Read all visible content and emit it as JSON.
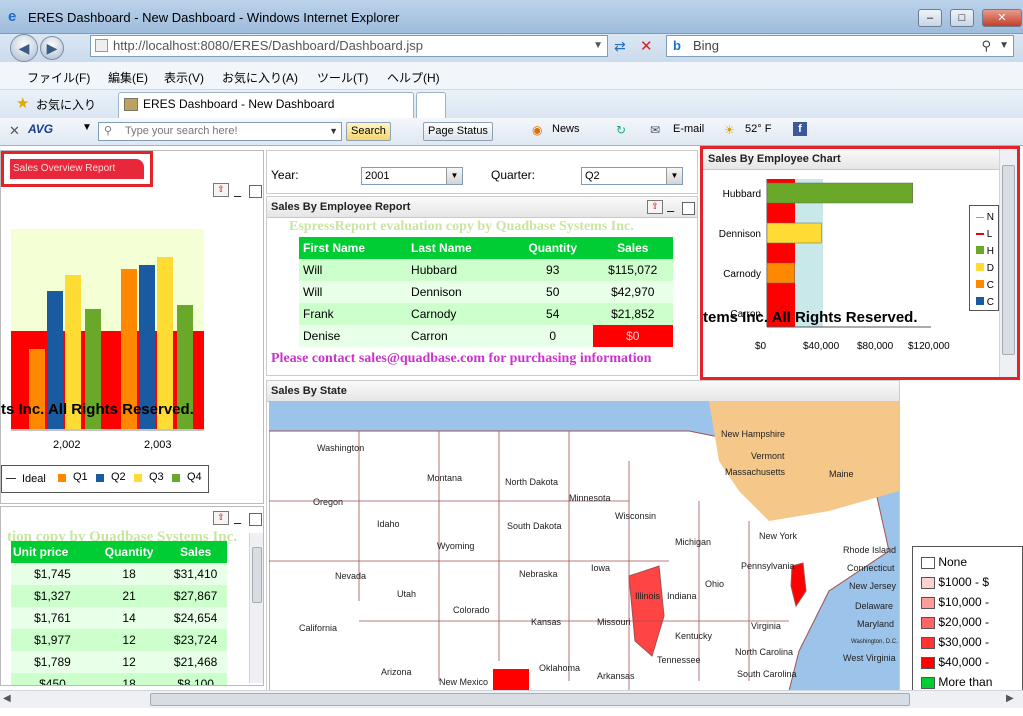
{
  "window": {
    "title": "ERES Dashboard - New Dashboard - Windows Internet Explorer",
    "min": "–",
    "max": "□",
    "close": "✕"
  },
  "address": {
    "url": "http://localhost:8080/ERES/Dashboard/Dashboard.jsp",
    "search_engine": "Bing"
  },
  "menu": [
    "ファイル(F)",
    "編集(E)",
    "表示(V)",
    "お気に入り(A)",
    "ツール(T)",
    "ヘルプ(H)"
  ],
  "favorites": {
    "label": "お気に入り",
    "tab_title": "ERES Dashboard - New Dashboard"
  },
  "toolbar": {
    "avg": "AVG",
    "search_placeholder": "Type your search here!",
    "search_btn": "Search",
    "page_status": "Page Status",
    "news": "News",
    "email": "E-mail",
    "weather": "52° F"
  },
  "left_panel": {
    "tab_label": "Sales Overview Report",
    "watermark": "ts Inc. All Rights Reserved.",
    "x_ticks": [
      "2,002",
      "2,003"
    ],
    "legend": [
      "Ideal",
      "Q1",
      "Q2",
      "Q3",
      "Q4"
    ],
    "table_watermark": "tion copy by Quadbase Systems Inc.",
    "table_headers": [
      "Unit price",
      "Quantity",
      "Sales"
    ],
    "table_rows": [
      [
        "$1,745",
        "18",
        "$31,410"
      ],
      [
        "$1,327",
        "21",
        "$27,867"
      ],
      [
        "$1,761",
        "14",
        "$24,654"
      ],
      [
        "$1,977",
        "12",
        "$23,724"
      ],
      [
        "$1,789",
        "12",
        "$21,468"
      ],
      [
        "$450",
        "18",
        "$8,100"
      ]
    ]
  },
  "filters": {
    "year_label": "Year:",
    "year_value": "2001",
    "quarter_label": "Quarter:",
    "quarter_value": "Q2"
  },
  "employee_report": {
    "title": "Sales By Employee Report",
    "watermark": "EspressReport evaluation copy by Quadbase Systems Inc.",
    "headers": [
      "First Name",
      "Last Name",
      "Quantity",
      "Sales"
    ],
    "rows": [
      [
        "Will",
        "Hubbard",
        "93",
        "$115,072"
      ],
      [
        "Will",
        "Dennison",
        "50",
        "$42,970"
      ],
      [
        "Frank",
        "Carnody",
        "54",
        "$21,852"
      ],
      [
        "Denise",
        "Carron",
        "0",
        "$0"
      ]
    ],
    "contact": "Please contact sales@quadbase.com for purchasing information"
  },
  "employee_chart": {
    "title": "Sales By Employee Chart",
    "watermark": "tems Inc. All Rights Reserved.",
    "categories": [
      "Hubbard",
      "Dennison",
      "Carnody",
      "Carron"
    ],
    "values": [
      115072,
      42970,
      21852,
      0
    ],
    "x_ticks": [
      "$0",
      "$40,000",
      "$80,000",
      "$120,000"
    ],
    "legend": [
      "N",
      "L",
      "H",
      "D",
      "C",
      "C"
    ]
  },
  "map": {
    "title": "Sales By State",
    "states": [
      "Washington",
      "Montana",
      "North Dakota",
      "Minnesota",
      "Oregon",
      "Idaho",
      "South Dakota",
      "Wisconsin",
      "Michigan",
      "Wyoming",
      "Nebraska",
      "Iowa",
      "Illinois",
      "Indiana",
      "Ohio",
      "Pennsylvania",
      "New York",
      "Nevada",
      "Utah",
      "Colorado",
      "Kansas",
      "Missouri",
      "Kentucky",
      "Virginia",
      "California",
      "Oklahoma",
      "Arkansas",
      "Tennessee",
      "North Carolina",
      "South Carolina",
      "Arizona",
      "New Mexico",
      "West Virginia",
      "Maine",
      "Vermont",
      "New Hampshire",
      "Massachusetts",
      "Rhode Island",
      "Connecticut",
      "New Jersey",
      "Delaware",
      "Maryland",
      "Washington, D.C."
    ],
    "legend": [
      "None",
      "$1000 - $",
      "$10,000 -",
      "$20,000 -",
      "$30,000 -",
      "$40,000 -",
      "More than"
    ]
  }
}
